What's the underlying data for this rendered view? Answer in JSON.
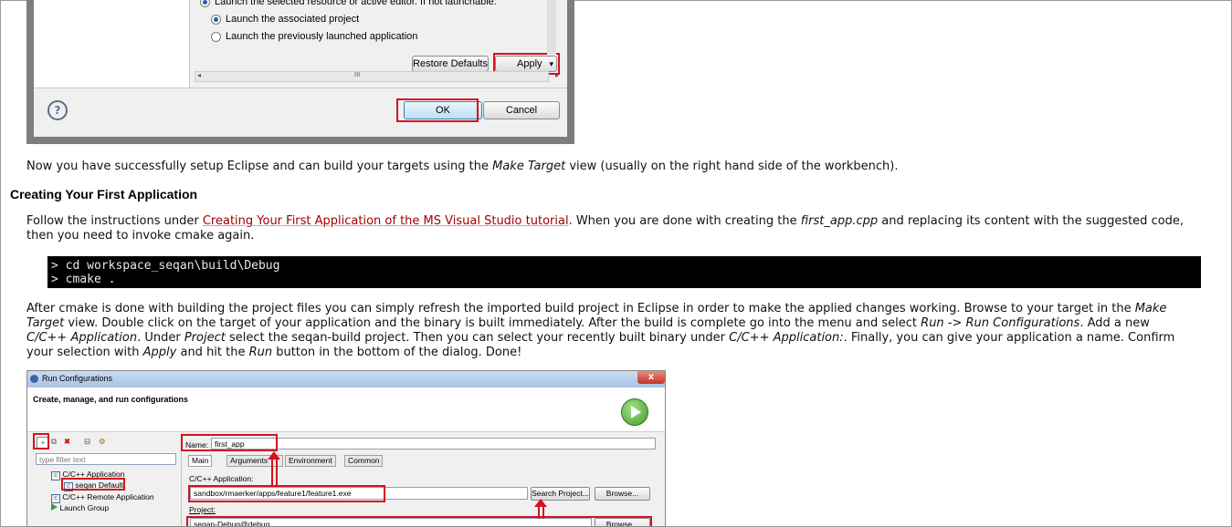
{
  "top_dialog": {
    "option_launch_resource": "Launch the selected resource or active editor. If not launchable:",
    "option_associated_project": "Launch the associated project",
    "option_previous_app": "Launch the previously launched application",
    "restore_defaults": "Restore Defaults",
    "apply": "Apply",
    "ok": "OK",
    "cancel": "Cancel",
    "help_glyph": "?",
    "scroll_glyph": "III",
    "arrow_left": "◂",
    "arrow_right": "▸",
    "dropdown_glyph": "▾"
  },
  "text": {
    "p1_a": "Now you have successfully setup Eclipse and can build your targets using the ",
    "p1_em": "Make Target",
    "p1_b": " view (usually on the right hand side of the workbench).",
    "heading": "Creating Your First Application",
    "p2_a": "Follow the instructions under ",
    "p2_link": "Creating Your First Application of the MS Visual Studio tutorial",
    "p2_b": ". When you are done with creating the ",
    "p2_em": "first_app.cpp",
    "p2_c": " and replacing its content with the suggested code,",
    "p2_line2": "then you need to invoke cmake again.",
    "code_line1": "> cd workspace_seqan\\build\\Debug",
    "code_line2": "> cmake .",
    "p3_l1_a": "After cmake is done with building the project files you can simply refresh the imported build project in Eclipse in order to make the applied changes working. Browse to your target in the ",
    "p3_l1_em": "Make",
    "p3_l2_em1": "Target",
    "p3_l2_a": " view. Double click on the target of your application and the binary is built immediately. After the build is complete go into the menu and select ",
    "p3_l2_em2": "Run -> Run Configurations",
    "p3_l2_b": ". Add a new",
    "p3_l3_em1": "C/C++ Application",
    "p3_l3_a": ". Under ",
    "p3_l3_em2": "Project",
    "p3_l3_b": " select the seqan-build project. Then you can select your recently built binary under ",
    "p3_l3_em3": "C/C++ Application:",
    "p3_l3_c": ". Finally, you can give your application a name. Confirm",
    "p3_l4_a": "your selection with ",
    "p3_l4_em1": "Apply",
    "p3_l4_b": " and hit the ",
    "p3_l4_em2": "Run",
    "p3_l4_c": " button in the bottom of the dialog. Done!"
  },
  "run_dialog": {
    "title": "Run Configurations",
    "close_glyph": "x",
    "header": "Create, manage, and run configurations",
    "filter_placeholder": "type filter text",
    "tree_cpp_app": "C/C++ Application",
    "tree_seqan_default": "seqan Default",
    "tree_cpp_remote": "C/C++ Remote Application",
    "tree_launch_group": "Launch Group",
    "name_label": "Name:",
    "name_value": "first_app",
    "tab_main": "Main",
    "tab_arguments": "Arguments",
    "tab_environment": "Environment",
    "tab_common": "Common",
    "cpp_app_label": "C/C++ Application:",
    "cpp_app_value": "sandbox/rmaerker/apps/feature1/feature1.exe",
    "search_project": "Search Project...",
    "browse": "Browse...",
    "project_label": "Project:",
    "project_value": "seqan-Debug@debug",
    "browse2": "Browse...",
    "toolbar_new": "+",
    "toolbar_copy": "⧉",
    "toolbar_delete": "✖",
    "toolbar_collapse": "⊟",
    "toolbar_filter": "⚙",
    "tree_icon_c": "c"
  },
  "colors": {
    "highlight": "#d4121f",
    "link": "#a00000",
    "code_bg": "#000000"
  }
}
